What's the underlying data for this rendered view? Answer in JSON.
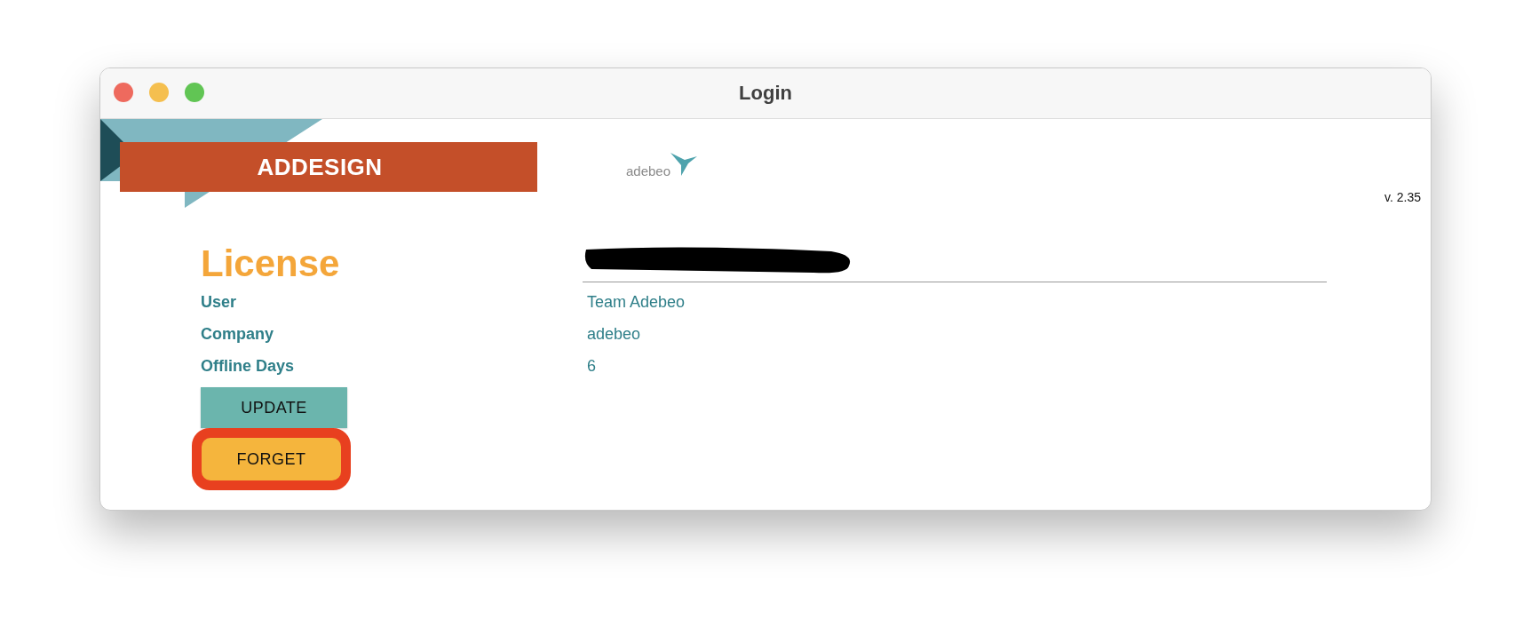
{
  "window": {
    "title": "Login"
  },
  "banner": {
    "brand": "ADDESIGN",
    "logo_text": "adebeo",
    "version": "v. 2.35"
  },
  "license": {
    "title": "License",
    "fields": [
      {
        "label": "User",
        "value": "Team Adebeo"
      },
      {
        "label": "Company",
        "value": "adebeo"
      },
      {
        "label": "Offline Days",
        "value": "6"
      }
    ]
  },
  "buttons": [
    {
      "label": "UPDATE",
      "kind": "update",
      "highlighted": false
    },
    {
      "label": "FORGET",
      "kind": "forget",
      "highlighted": true
    }
  ]
}
